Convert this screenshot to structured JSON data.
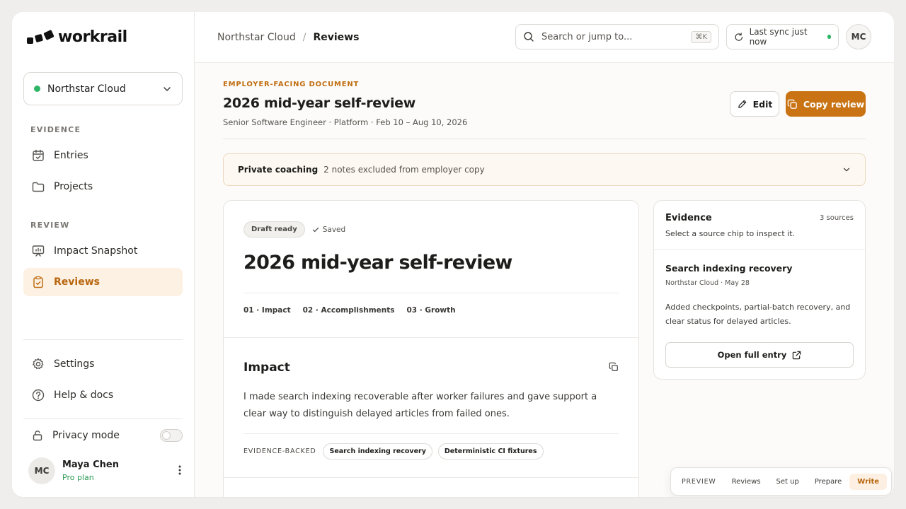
{
  "brand": {
    "name": "workrail"
  },
  "workspace": {
    "name": "Northstar Cloud"
  },
  "sidebar": {
    "evidence_label": "EVIDENCE",
    "review_label": "REVIEW",
    "evidence_items": [
      {
        "label": "Entries",
        "icon": "calendar-check-icon"
      },
      {
        "label": "Projects",
        "icon": "folder-icon"
      }
    ],
    "review_items": [
      {
        "label": "Impact Snapshot",
        "icon": "presentation-chart-icon"
      },
      {
        "label": "Reviews",
        "icon": "clipboard-check-icon",
        "active": true
      }
    ],
    "bottom_items": [
      {
        "label": "Settings",
        "icon": "gear-icon"
      },
      {
        "label": "Help & docs",
        "icon": "help-circle-icon"
      }
    ],
    "privacy": {
      "label": "Privacy mode",
      "enabled": false
    },
    "user": {
      "initials": "MC",
      "name": "Maya Chen",
      "plan": "Pro plan"
    }
  },
  "topbar": {
    "breadcrumb": {
      "parent": "Northstar Cloud",
      "separator": "/",
      "current": "Reviews"
    },
    "search": {
      "placeholder": "Search or jump to...",
      "shortcut": "⌘K"
    },
    "sync": {
      "label": "Last sync just now"
    },
    "avatar_initials": "MC"
  },
  "header": {
    "eyebrow": "EMPLOYER-FACING DOCUMENT",
    "title": "2026 mid-year self-review",
    "meta": "Senior Software Engineer · Platform · Feb 10 – Aug 10, 2026",
    "edit_label": "Edit",
    "copy_label": "Copy review"
  },
  "coaching": {
    "title": "Private coaching",
    "subtitle": "2 notes excluded from employer copy"
  },
  "document": {
    "status_pill": "Draft ready",
    "saved_label": "Saved",
    "title": "2026 mid-year self-review",
    "toc": [
      "01 · Impact",
      "02 · Accomplishments",
      "03 · Growth"
    ],
    "section": {
      "title": "Impact",
      "body": "I made search indexing recoverable after worker failures and gave support a clear way to distinguish delayed articles from failed ones.",
      "evidence_label": "EVIDENCE-BACKED",
      "chips": [
        "Search indexing recovery",
        "Deterministic CI fixtures"
      ]
    }
  },
  "evidence_panel": {
    "title": "Evidence",
    "count": "3 sources",
    "subtitle": "Select a source chip to inspect it.",
    "item": {
      "title": "Search indexing recovery",
      "meta": "Northstar Cloud · May 28",
      "description": "Added checkpoints, partial-batch recovery, and clear status for delayed articles.",
      "open_label": "Open full entry"
    }
  },
  "flow_bar": {
    "tag": "PREVIEW",
    "tabs": [
      "Reviews",
      "Set up",
      "Prepare",
      "Write"
    ],
    "active": "Write"
  },
  "colors": {
    "accent": "#c97314",
    "accent_soft": "#fdf1e4",
    "status_green": "#2fb566"
  }
}
